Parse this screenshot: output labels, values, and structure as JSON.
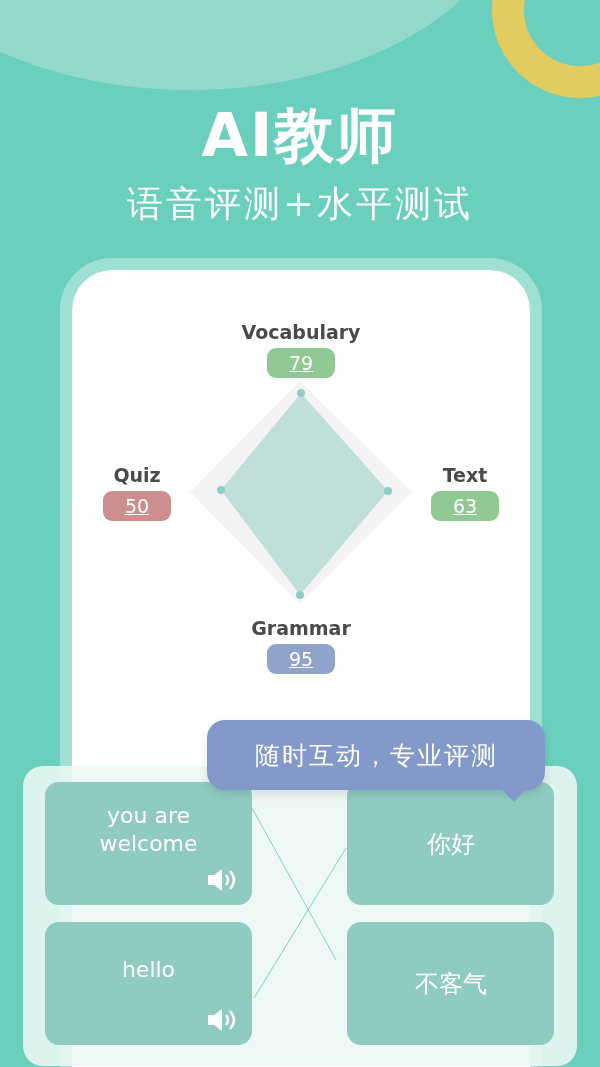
{
  "title": "AI教师",
  "subtitle": "语音评测+水平测试",
  "scores": [
    {
      "label": "Vocabulary",
      "value": "79",
      "color": "#91c995"
    },
    {
      "label": "Quiz",
      "value": "50",
      "color": "#cc8e8e"
    },
    {
      "label": "Text",
      "value": "63",
      "color": "#91c995"
    },
    {
      "label": "Grammar",
      "value": "95",
      "color": "#8fa3cb"
    }
  ],
  "bubble": "随时互动，专业评测",
  "cards": [
    {
      "text": "you are welcome",
      "audio": true
    },
    {
      "text": "你好",
      "audio": false
    },
    {
      "text": "hello",
      "audio": true
    },
    {
      "text": "不客气",
      "audio": false
    }
  ]
}
